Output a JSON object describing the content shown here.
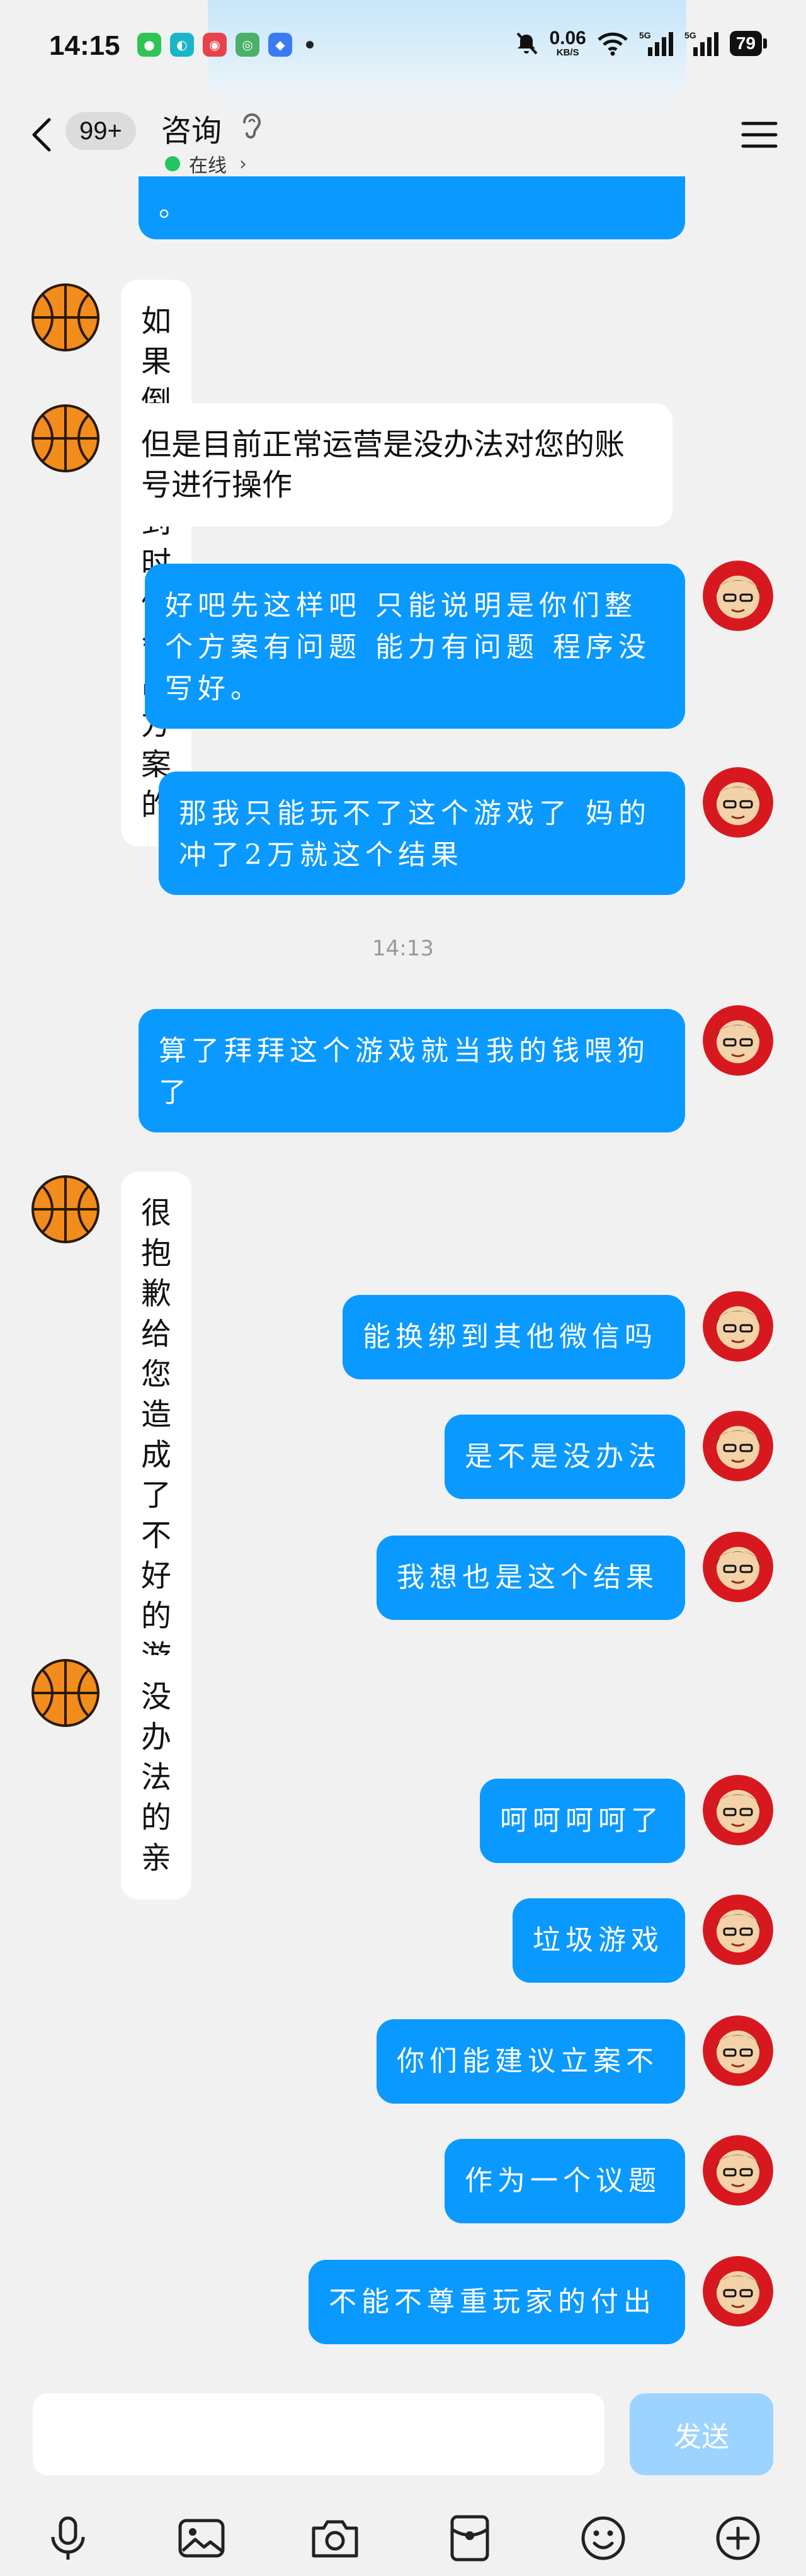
{
  "status_bar": {
    "time": "14:15",
    "net_speed": "0.06",
    "net_unit": "KB/S",
    "signal1": "5G",
    "signal2": "5G",
    "battery": "79",
    "app_icons": [
      "wechat-icon",
      "message-icon",
      "weibo-icon",
      "mobile-icon",
      "app-icon"
    ]
  },
  "header": {
    "badge": "99+",
    "title": "咨询",
    "status": "在线"
  },
  "messages": [
    {
      "side": "out",
      "text": "。"
    },
    {
      "side": "in",
      "text": "如果倒闭了到时候会出方案的"
    },
    {
      "side": "in",
      "text": "但是目前正常运营是没办法对您的账号进行操作"
    },
    {
      "side": "out",
      "text": "好吧先这样吧 只能说明是你们整个方案有问题 能力有问题 程序没写好。"
    },
    {
      "side": "out",
      "text": "那我只能玩不了这个游戏了 妈的冲了2万就这个结果"
    },
    {
      "side": "time",
      "text": "14:13"
    },
    {
      "side": "out",
      "text": "算了拜拜这个游戏就当我的钱喂狗了"
    },
    {
      "side": "in",
      "text": "很抱歉给您造成了不好的游戏体验"
    },
    {
      "side": "out",
      "text": "能换绑到其他微信吗"
    },
    {
      "side": "out",
      "text": "是不是没办法"
    },
    {
      "side": "out",
      "text": "我想也是这个结果"
    },
    {
      "side": "in",
      "text": "没办法的亲"
    },
    {
      "side": "out",
      "text": "呵呵呵呵了"
    },
    {
      "side": "out",
      "text": "垃圾游戏"
    },
    {
      "side": "out",
      "text": "你们能建议立案不"
    },
    {
      "side": "out",
      "text": "作为一个议题"
    },
    {
      "side": "out",
      "text": "不能不尊重玩家的付出"
    }
  ],
  "input": {
    "placeholder": "",
    "send_label": "发送"
  },
  "toolbar": [
    "microphone-icon",
    "image-icon",
    "camera-icon",
    "red-packet-icon",
    "emoji-icon",
    "plus-icon"
  ],
  "colors": {
    "outgoing_bubble": "#0a99ff",
    "incoming_bubble": "#ffffff",
    "send_disabled": "#9dd3ff",
    "online": "#22c55e"
  }
}
